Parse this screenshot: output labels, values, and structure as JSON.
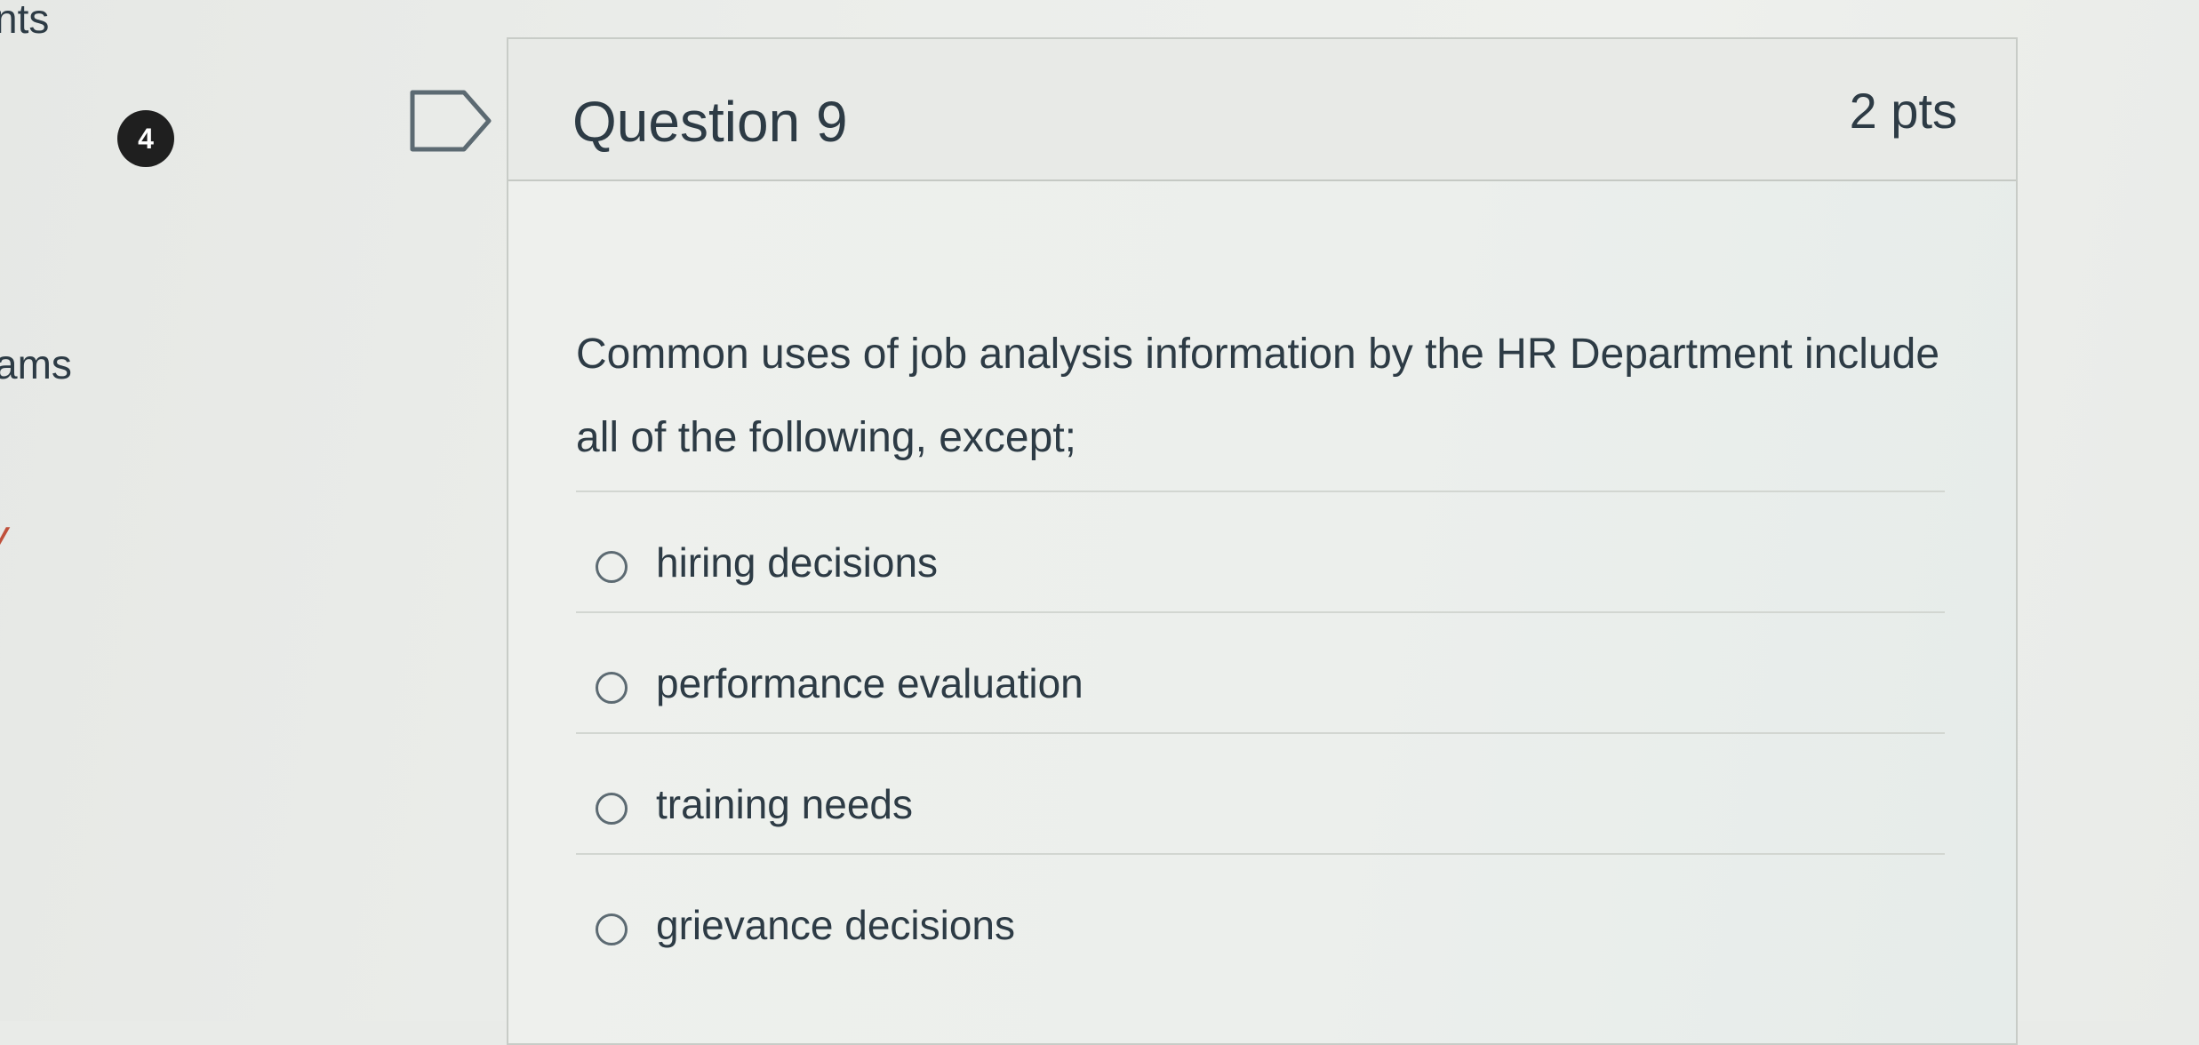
{
  "course_nav": {
    "items": [
      {
        "label": "nts"
      },
      {
        "label": "ams"
      },
      {
        "label": "y"
      }
    ]
  },
  "question": {
    "number_badge": "4",
    "flag_icon": "flag-question-icon",
    "title": "Question 9",
    "points": "2 pts",
    "text": "Common uses of job analysis information by the HR Department include all of the following, except;",
    "answers": [
      {
        "label": "hiring decisions",
        "selected": false
      },
      {
        "label": "performance evaluation",
        "selected": false
      },
      {
        "label": "training needs",
        "selected": false
      },
      {
        "label": "grievance decisions",
        "selected": false
      }
    ]
  },
  "colors": {
    "text": "#2d3b45",
    "accent_nav": "#c0503b",
    "badge": "#1f1f1f"
  }
}
